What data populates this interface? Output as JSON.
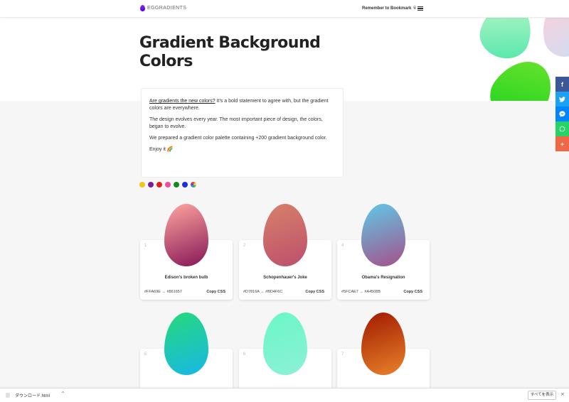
{
  "header": {
    "logo_text": "EGGRADIENTS",
    "bookmark_label": "Remember to Bookmark",
    "bookmark_icon": "☟"
  },
  "hero": {
    "title": "Gradient Background Colors"
  },
  "intro": {
    "link_text": "Are gradients the new colors?",
    "p1_rest": " It's a bold statement to agree with, but the gradient colors are everywhere.",
    "p2": "The design evolves every year. The most important piece of design, the colors, began to evolve.",
    "p3": "We prepared a gradient color palette containing +200 gradient background color.",
    "p4": "Enjoy it 🌈"
  },
  "color_filters": [
    {
      "name": "yellow",
      "color": "#f5c518"
    },
    {
      "name": "purple",
      "color": "#7b1fa2"
    },
    {
      "name": "red",
      "color": "#e0201b"
    },
    {
      "name": "pink",
      "color": "#ec4f9e"
    },
    {
      "name": "green",
      "color": "#138a1c"
    },
    {
      "name": "blue",
      "color": "#1e2fd4"
    },
    {
      "name": "all",
      "color": "rainbow"
    }
  ],
  "social": {
    "facebook": "f",
    "twitter": "t",
    "messenger": "m",
    "whatsapp": "w",
    "more": "+"
  },
  "cards": [
    {
      "num": "1",
      "name": "Edison's broken bulb",
      "from": "#FFA69E",
      "to": "#861657",
      "copy": "Copy CSS",
      "colors_text": "#FFA69E → #861657"
    },
    {
      "num": "2",
      "name": "Schopenhauer's Joke",
      "from": "#D7816A",
      "to": "#BD4F6C",
      "copy": "Copy CSS",
      "colors_text": "#D7816A → #BD4F6C"
    },
    {
      "num": "4",
      "name": "Obama's Resignation",
      "from": "#5FCAE7",
      "to": "#A4508B",
      "copy": "Copy CSS",
      "colors_text": "#5FCAE7 → #A4508B"
    },
    {
      "num": "5",
      "name": "",
      "from": "#26D97A",
      "to": "#17B8E6",
      "copy": "",
      "colors_text": ""
    },
    {
      "num": "6",
      "name": "",
      "from": "#6BF7C6",
      "to": "#8CF0D8",
      "copy": "",
      "colors_text": ""
    },
    {
      "num": "7",
      "name": "",
      "from": "#A11A00",
      "to": "#E8822A",
      "copy": "",
      "colors_text": ""
    }
  ],
  "download_bar": {
    "file_name": "ダウンロード.html",
    "show_all": "すべてを表示",
    "close": "×",
    "chevron": "^"
  }
}
